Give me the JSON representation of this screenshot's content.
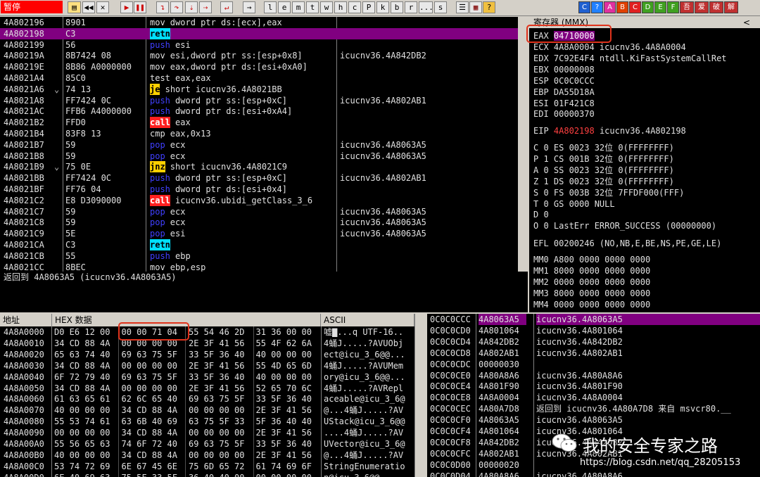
{
  "toolbar": {
    "status": "暂停",
    "buttons": [
      "l",
      "e",
      "m",
      "t",
      "w",
      "h",
      "c",
      "P",
      "k",
      "b",
      "r",
      "...",
      "s"
    ],
    "right_buttons": [
      "C",
      "?",
      "A",
      "B",
      "C",
      "D",
      "E",
      "F",
      "吾",
      "爱",
      "破",
      "解"
    ]
  },
  "cpu": {
    "rows": [
      {
        "addr": "4A802196",
        "mark": "",
        "hex": "8901",
        "kw": "mov",
        "kw_type": "def",
        "ops": "dword ptr ds:[ecx],eax",
        "cmt": "",
        "sel": false
      },
      {
        "addr": "4A802198",
        "mark": "",
        "hex": "C3",
        "kw": "retn",
        "kw_type": "ret",
        "ops": "",
        "cmt": "",
        "sel": true
      },
      {
        "addr": "4A802199",
        "mark": "",
        "hex": "56",
        "kw": "push",
        "kw_type": "push",
        "ops": "esi",
        "cmt": "",
        "sel": false
      },
      {
        "addr": "4A80219A",
        "mark": "",
        "hex": "8B7424 08",
        "kw": "mov",
        "kw_type": "def",
        "ops": "esi,dword ptr ss:[esp+0x8]",
        "cmt": "icucnv36.4A842DB2",
        "sel": false
      },
      {
        "addr": "4A80219E",
        "mark": "",
        "hex": "8B86 A0000000",
        "kw": "mov",
        "kw_type": "def",
        "ops": "eax,dword ptr ds:[esi+0xA0]",
        "cmt": "",
        "sel": false
      },
      {
        "addr": "4A8021A4",
        "mark": "",
        "hex": "85C0",
        "kw": "test",
        "kw_type": "def",
        "ops": "eax,eax",
        "cmt": "",
        "sel": false
      },
      {
        "addr": "4A8021A6",
        "mark": "⌄",
        "hex": "74 13",
        "kw": "je",
        "kw_type": "jmp",
        "ops": "short icucnv36.4A8021BB",
        "cmt": "",
        "sel": false
      },
      {
        "addr": "4A8021A8",
        "mark": "",
        "hex": "FF7424 0C",
        "kw": "push",
        "kw_type": "push",
        "ops": "dword ptr ss:[esp+0xC]",
        "cmt": "icucnv36.4A802AB1",
        "sel": false
      },
      {
        "addr": "4A8021AC",
        "mark": "",
        "hex": "FFB6 A4000000",
        "kw": "push",
        "kw_type": "push",
        "ops": "dword ptr ds:[esi+0xA4]",
        "cmt": "",
        "sel": false
      },
      {
        "addr": "4A8021B2",
        "mark": "",
        "hex": "FFD0",
        "kw": "call",
        "kw_type": "call",
        "ops": "eax",
        "cmt": "",
        "sel": false
      },
      {
        "addr": "4A8021B4",
        "mark": "",
        "hex": "83F8 13",
        "kw": "cmp",
        "kw_type": "def",
        "ops": "eax,0x13",
        "cmt": "",
        "sel": false
      },
      {
        "addr": "4A8021B7",
        "mark": "",
        "hex": "59",
        "kw": "pop",
        "kw_type": "pop",
        "ops": "ecx",
        "cmt": "icucnv36.4A8063A5",
        "sel": false
      },
      {
        "addr": "4A8021B8",
        "mark": "",
        "hex": "59",
        "kw": "pop",
        "kw_type": "pop",
        "ops": "ecx",
        "cmt": "icucnv36.4A8063A5",
        "sel": false
      },
      {
        "addr": "4A8021B9",
        "mark": "⌄",
        "hex": "75 0E",
        "kw": "jnz",
        "kw_type": "jmp",
        "ops": "short icucnv36.4A8021C9",
        "cmt": "",
        "sel": false
      },
      {
        "addr": "4A8021BB",
        "mark": "",
        "hex": "FF7424 0C",
        "kw": "push",
        "kw_type": "push",
        "ops": "dword ptr ss:[esp+0xC]",
        "cmt": "icucnv36.4A802AB1",
        "sel": false
      },
      {
        "addr": "4A8021BF",
        "mark": "",
        "hex": "FF76 04",
        "kw": "push",
        "kw_type": "push",
        "ops": "dword ptr ds:[esi+0x4]",
        "cmt": "",
        "sel": false
      },
      {
        "addr": "4A8021C2",
        "mark": "",
        "hex": "E8 D3090000",
        "kw": "call",
        "kw_type": "call",
        "ops": "icucnv36.ubidi_getClass_3_6",
        "cmt": "",
        "sel": false
      },
      {
        "addr": "4A8021C7",
        "mark": "",
        "hex": "59",
        "kw": "pop",
        "kw_type": "pop",
        "ops": "ecx",
        "cmt": "icucnv36.4A8063A5",
        "sel": false
      },
      {
        "addr": "4A8021C8",
        "mark": "",
        "hex": "59",
        "kw": "pop",
        "kw_type": "pop",
        "ops": "ecx",
        "cmt": "icucnv36.4A8063A5",
        "sel": false
      },
      {
        "addr": "4A8021C9",
        "mark": "",
        "hex": "5E",
        "kw": "pop",
        "kw_type": "pop",
        "ops": "esi",
        "cmt": "icucnv36.4A8063A5",
        "sel": false
      },
      {
        "addr": "4A8021CA",
        "mark": "",
        "hex": "C3",
        "kw": "retn",
        "kw_type": "ret",
        "ops": "",
        "cmt": "",
        "sel": false
      },
      {
        "addr": "4A8021CB",
        "mark": "",
        "hex": "55",
        "kw": "push",
        "kw_type": "push",
        "ops": "ebp",
        "cmt": "",
        "sel": false
      },
      {
        "addr": "4A8021CC",
        "mark": "",
        "hex": "8BEC",
        "kw": "mov",
        "kw_type": "def",
        "ops": "ebp,esp",
        "cmt": "",
        "sel": false
      }
    ]
  },
  "info": {
    "text": "返回到 4A8063A5 (icucnv36.4A8063A5)"
  },
  "regs": {
    "title": "寄存器 (MMX)",
    "collapse": "<",
    "eax_name": "EAX",
    "eax_value": "04710000",
    "general": [
      "ECX 4A8A0004 icucnv36.4A8A0004",
      "EDX 7C92E4F4 ntdll.KiFastSystemCallRet",
      "EBX 00000008",
      "ESP 0C0C0CCC",
      "EBP DA55D18A",
      "ESI 01F421C8",
      "EDI 00000370"
    ],
    "eip_name": "EIP",
    "eip_value": "4A802198",
    "eip_comment": "icucnv36.4A802198",
    "flags": [
      "C 0  ES 0023 32位 0(FFFFFFFF)",
      "P 1  CS 001B 32位 0(FFFFFFFF)",
      "A 0  SS 0023 32位 0(FFFFFFFF)",
      "Z 1  DS 0023 32位 0(FFFFFFFF)",
      "S 0  FS 003B 32位 7FFDF000(FFF)",
      "T 0  GS 0000 NULL",
      "D 0",
      "O 0  LastErr ERROR_SUCCESS (00000000)"
    ],
    "efl": "EFL 00200246 (NO,NB,E,BE,NS,PE,GE,LE)",
    "mmx": [
      "MM0 A800 0000 0000 0000",
      "MM1 8000 0000 0000 0000",
      "MM2 0000 0000 0000 0000",
      "MM3 8000 0000 0000 0000",
      "MM4 0000 0000 0000 0000"
    ]
  },
  "dump": {
    "headers": {
      "addr": "地址",
      "hex": "HEX 数据",
      "ascii": "ASCII"
    },
    "rows": [
      {
        "addr": "4A8A0000",
        "hex": [
          "D0 E6 12 00",
          "00 00 71 04",
          "55 54 46 2D",
          "31 36 00 00"
        ],
        "ascii": "嘘▇...q UTF-16.."
      },
      {
        "addr": "4A8A0010",
        "hex": [
          "34 CD 88 4A",
          "00 00 00 00",
          "2E 3F 41 56",
          "55 4F 62 6A"
        ],
        "ascii": "4蛹J.....?AVUObj"
      },
      {
        "addr": "4A8A0020",
        "hex": [
          "65 63 74 40",
          "69 63 75 5F",
          "33 5F 36 40",
          "40 00 00 00"
        ],
        "ascii": "ect@icu_3_6@@..."
      },
      {
        "addr": "4A8A0030",
        "hex": [
          "34 CD 88 4A",
          "00 00 00 00",
          "2E 3F 41 56",
          "55 4D 65 6D"
        ],
        "ascii": "4蛹J.....?AVUMem"
      },
      {
        "addr": "4A8A0040",
        "hex": [
          "6F 72 79 40",
          "69 63 75 5F",
          "33 5F 36 40",
          "40 00 00 00"
        ],
        "ascii": "ory@icu_3_6@@..."
      },
      {
        "addr": "4A8A0050",
        "hex": [
          "34 CD 88 4A",
          "00 00 00 00",
          "2E 3F 41 56",
          "52 65 70 6C"
        ],
        "ascii": "4蛹J.....?AVRepl"
      },
      {
        "addr": "4A8A0060",
        "hex": [
          "61 63 65 61",
          "62 6C 65 40",
          "69 63 75 5F",
          "33 5F 36 40"
        ],
        "ascii": "aceable@icu_3_6@"
      },
      {
        "addr": "4A8A0070",
        "hex": [
          "40 00 00 00",
          "34 CD 88 4A",
          "00 00 00 00",
          "2E 3F 41 56"
        ],
        "ascii": "@...4蛹J.....?AV"
      },
      {
        "addr": "4A8A0080",
        "hex": [
          "55 53 74 61",
          "63 6B 40 69",
          "63 75 5F 33",
          "5F 36 40 40"
        ],
        "ascii": "UStack@icu_3_6@@"
      },
      {
        "addr": "4A8A0090",
        "hex": [
          "00 00 00 00",
          "34 CD 88 4A",
          "00 00 00 00",
          "2E 3F 41 56"
        ],
        "ascii": "....4蛹J.....?AV"
      },
      {
        "addr": "4A8A00A0",
        "hex": [
          "55 56 65 63",
          "74 6F 72 40",
          "69 63 75 5F",
          "33 5F 36 40"
        ],
        "ascii": "UVector@icu_3_6@"
      },
      {
        "addr": "4A8A00B0",
        "hex": [
          "40 00 00 00",
          "34 CD 88 4A",
          "00 00 00 00",
          "2E 3F 41 56"
        ],
        "ascii": "@...4蛹J.....?AV"
      },
      {
        "addr": "4A8A00C0",
        "hex": [
          "53 74 72 69",
          "6E 67 45 6E",
          "75 6D 65 72",
          "61 74 69 6F"
        ],
        "ascii": "StringEnumeratio"
      },
      {
        "addr": "4A8A00D0",
        "hex": [
          "6E 40 69 63",
          "75 5F 33 5F",
          "36 40 40 00",
          "00 00 00 00"
        ],
        "ascii": "n@icu_3_6@@....."
      }
    ]
  },
  "stack": {
    "rows": [
      {
        "addr": "0C0C0CCC",
        "val": "4A8063A5",
        "cmt": "icucnv36.4A8063A5",
        "sel": true
      },
      {
        "addr": "0C0C0CD0",
        "val": "4A801064",
        "cmt": "icucnv36.4A801064",
        "sel": false
      },
      {
        "addr": "0C0C0CD4",
        "val": "4A842DB2",
        "cmt": "icucnv36.4A842DB2",
        "sel": false
      },
      {
        "addr": "0C0C0CD8",
        "val": "4A802AB1",
        "cmt": "icucnv36.4A802AB1",
        "sel": false
      },
      {
        "addr": "0C0C0CDC",
        "val": "00000030",
        "cmt": "",
        "sel": false
      },
      {
        "addr": "0C0C0CE0",
        "val": "4A80A8A6",
        "cmt": "icucnv36.4A80A8A6",
        "sel": false
      },
      {
        "addr": "0C0C0CE4",
        "val": "4A801F90",
        "cmt": "icucnv36.4A801F90",
        "sel": false
      },
      {
        "addr": "0C0C0CE8",
        "val": "4A8A0004",
        "cmt": "icucnv36.4A8A0004",
        "sel": false
      },
      {
        "addr": "0C0C0CEC",
        "val": "4A80A7D8",
        "cmt": "返回到 icucnv36.4A80A7D8 来自 msvcr80.__",
        "sel": false
      },
      {
        "addr": "0C0C0CF0",
        "val": "4A8063A5",
        "cmt": "icucnv36.4A8063A5",
        "sel": false
      },
      {
        "addr": "0C0C0CF4",
        "val": "4A801064",
        "cmt": "icucnv36.4A801064",
        "sel": false
      },
      {
        "addr": "0C0C0CF8",
        "val": "4A842DB2",
        "cmt": "icucnv36.4A842DB2",
        "sel": false
      },
      {
        "addr": "0C0C0CFC",
        "val": "4A802AB1",
        "cmt": "icucnv36.4A802AB1",
        "sel": false
      },
      {
        "addr": "0C0C0D00",
        "val": "00000020",
        "cmt": "",
        "sel": false
      },
      {
        "addr": "0C0C0D04",
        "val": "4A80A8A6",
        "cmt": "icucnv36.4A80A8A6",
        "sel": false
      }
    ]
  },
  "watermark": {
    "name": "我的安全专家之路",
    "url": "https://blog.csdn.net/qq_28205153"
  }
}
